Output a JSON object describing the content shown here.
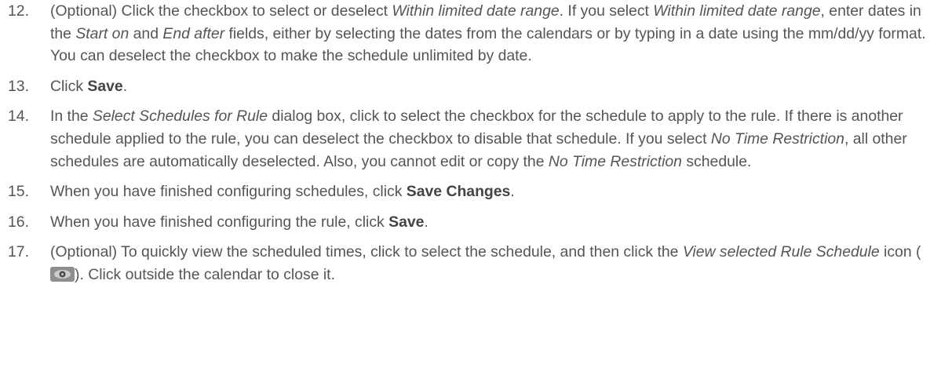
{
  "steps": [
    {
      "number": "12.",
      "segments": [
        {
          "t": "(Optional) Click the checkbox to select or deselect ",
          "s": "n"
        },
        {
          "t": "Within limited date range",
          "s": "i"
        },
        {
          "t": ". If you select ",
          "s": "n"
        },
        {
          "t": "Within limited date range",
          "s": "i"
        },
        {
          "t": ", enter dates in the ",
          "s": "n"
        },
        {
          "t": "Start on",
          "s": "i"
        },
        {
          "t": " and ",
          "s": "n"
        },
        {
          "t": "End after",
          "s": "i"
        },
        {
          "t": " fields, either by selecting the dates from the calendars or by typing in a date using the mm/dd/yy format. You can deselect the checkbox to make the schedule unlimited by date.",
          "s": "n"
        }
      ]
    },
    {
      "number": "13.",
      "segments": [
        {
          "t": "Click ",
          "s": "n"
        },
        {
          "t": "Save",
          "s": "b"
        },
        {
          "t": ".",
          "s": "n"
        }
      ]
    },
    {
      "number": "14.",
      "segments": [
        {
          "t": "In the ",
          "s": "n"
        },
        {
          "t": "Select Schedules for Rule",
          "s": "i"
        },
        {
          "t": " dialog box, click to select the checkbox for the schedule to apply to the rule. If there is another schedule applied to the rule, you can deselect the checkbox to disable that schedule. If you select ",
          "s": "n"
        },
        {
          "t": "No Time Restriction",
          "s": "i"
        },
        {
          "t": ", all other schedules are automatically deselected. Also, you cannot edit or copy the ",
          "s": "n"
        },
        {
          "t": "No Time Restriction",
          "s": "i"
        },
        {
          "t": " schedule.",
          "s": "n"
        }
      ]
    },
    {
      "number": "15.",
      "segments": [
        {
          "t": "When you have finished configuring schedules, click ",
          "s": "n"
        },
        {
          "t": "Save Changes",
          "s": "b"
        },
        {
          "t": ".",
          "s": "n"
        }
      ]
    },
    {
      "number": "16.",
      "segments": [
        {
          "t": "When you have finished configuring the rule, click ",
          "s": "n"
        },
        {
          "t": "Save",
          "s": "b"
        },
        {
          "t": ".",
          "s": "n"
        }
      ]
    },
    {
      "number": "17.",
      "segments": [
        {
          "t": "(Optional) To quickly view the scheduled times, click to select the schedule, and then click the ",
          "s": "n"
        },
        {
          "t": "View selected Rule Schedule",
          "s": "i"
        },
        {
          "t": " icon (",
          "s": "n"
        },
        {
          "t": "",
          "s": "icon",
          "icon": "eye-icon"
        },
        {
          "t": "). Click outside the calendar to close it.",
          "s": "n"
        }
      ]
    }
  ]
}
